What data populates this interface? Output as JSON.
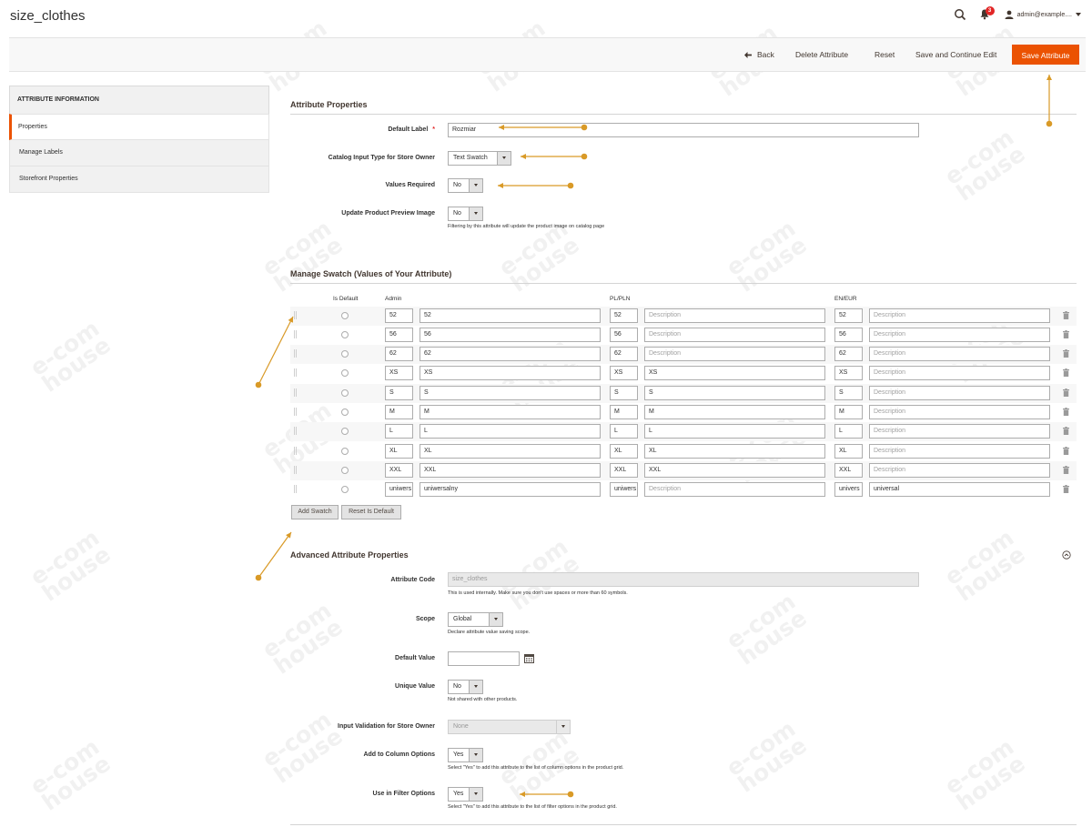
{
  "header": {
    "title": "size_clothes",
    "notification_count": "3",
    "admin_user": "admin@example...."
  },
  "actions": {
    "back": "Back",
    "delete": "Delete Attribute",
    "reset": "Reset",
    "save_continue": "Save and Continue Edit",
    "save": "Save Attribute"
  },
  "sidebar": {
    "heading": "ATTRIBUTE INFORMATION",
    "items": [
      {
        "label": "Properties"
      },
      {
        "label": "Manage Labels"
      },
      {
        "label": "Storefront Properties"
      }
    ]
  },
  "properties": {
    "section_title": "Attribute Properties",
    "default_label": {
      "label": "Default Label",
      "required": "*",
      "value": "Rozmiar"
    },
    "input_type": {
      "label": "Catalog Input Type for Store Owner",
      "value": "Text Swatch"
    },
    "values_required": {
      "label": "Values Required",
      "value": "No"
    },
    "update_preview": {
      "label": "Update Product Preview Image",
      "value": "No",
      "note": "Filtering by this attribute will update the product image on catalog page"
    }
  },
  "swatch": {
    "section_title": "Manage Swatch (Values of Your Attribute)",
    "columns": {
      "is_default": "Is Default",
      "admin": "Admin",
      "pl": "PL/PLN",
      "en": "EN/EUR"
    },
    "rows": [
      {
        "admin_code": "52",
        "admin_desc": "52",
        "pl_code": "52",
        "pl_desc": "Description",
        "en_code": "52",
        "en_desc": "Description"
      },
      {
        "admin_code": "56",
        "admin_desc": "56",
        "pl_code": "56",
        "pl_desc": "Description",
        "en_code": "56",
        "en_desc": "Description"
      },
      {
        "admin_code": "62",
        "admin_desc": "62",
        "pl_code": "62",
        "pl_desc": "Description",
        "en_code": "62",
        "en_desc": "Description"
      },
      {
        "admin_code": "XS",
        "admin_desc": "XS",
        "pl_code": "XS",
        "pl_desc": "XS",
        "en_code": "XS",
        "en_desc": "Description"
      },
      {
        "admin_code": "S",
        "admin_desc": "S",
        "pl_code": "S",
        "pl_desc": "S",
        "en_code": "S",
        "en_desc": "Description"
      },
      {
        "admin_code": "M",
        "admin_desc": "M",
        "pl_code": "M",
        "pl_desc": "M",
        "en_code": "M",
        "en_desc": "Description"
      },
      {
        "admin_code": "L",
        "admin_desc": "L",
        "pl_code": "L",
        "pl_desc": "L",
        "en_code": "L",
        "en_desc": "Description"
      },
      {
        "admin_code": "XL",
        "admin_desc": "XL",
        "pl_code": "XL",
        "pl_desc": "XL",
        "en_code": "XL",
        "en_desc": "Description"
      },
      {
        "admin_code": "XXL",
        "admin_desc": "XXL",
        "pl_code": "XXL",
        "pl_desc": "XXL",
        "en_code": "XXL",
        "en_desc": "Description"
      },
      {
        "admin_code": "uniwers",
        "admin_desc": "uniwersalny",
        "pl_code": "uniwers",
        "pl_desc": "Description",
        "en_code": "univers",
        "en_desc": "universal"
      }
    ],
    "placeholder": "Description",
    "add_button": "Add Swatch",
    "reset_button": "Reset Is Default"
  },
  "advanced": {
    "section_title": "Advanced Attribute Properties",
    "attribute_code": {
      "label": "Attribute Code",
      "value": "size_clothes",
      "note": "This is used internally. Make sure you don't use spaces or more than 60 symbols."
    },
    "scope": {
      "label": "Scope",
      "value": "Global",
      "note": "Declare attribute value saving scope."
    },
    "default_value": {
      "label": "Default Value",
      "value": ""
    },
    "unique_value": {
      "label": "Unique Value",
      "value": "No",
      "note": "Not shared with other products."
    },
    "input_validation": {
      "label": "Input Validation for Store Owner",
      "value": "None"
    },
    "add_to_column": {
      "label": "Add to Column Options",
      "value": "Yes",
      "note": "Select \"Yes\" to add this attribute to the list of column options in the product grid."
    },
    "use_in_filter": {
      "label": "Use in Filter Options",
      "value": "Yes",
      "note": "Select \"Yes\" to add this attribute to the list of filter options in the product grid."
    }
  },
  "watermark": {
    "line1": "e-com",
    "line2": "house"
  },
  "colors": {
    "accent": "#eb5202",
    "annotation": "#d99a27",
    "badge": "#e22626"
  }
}
